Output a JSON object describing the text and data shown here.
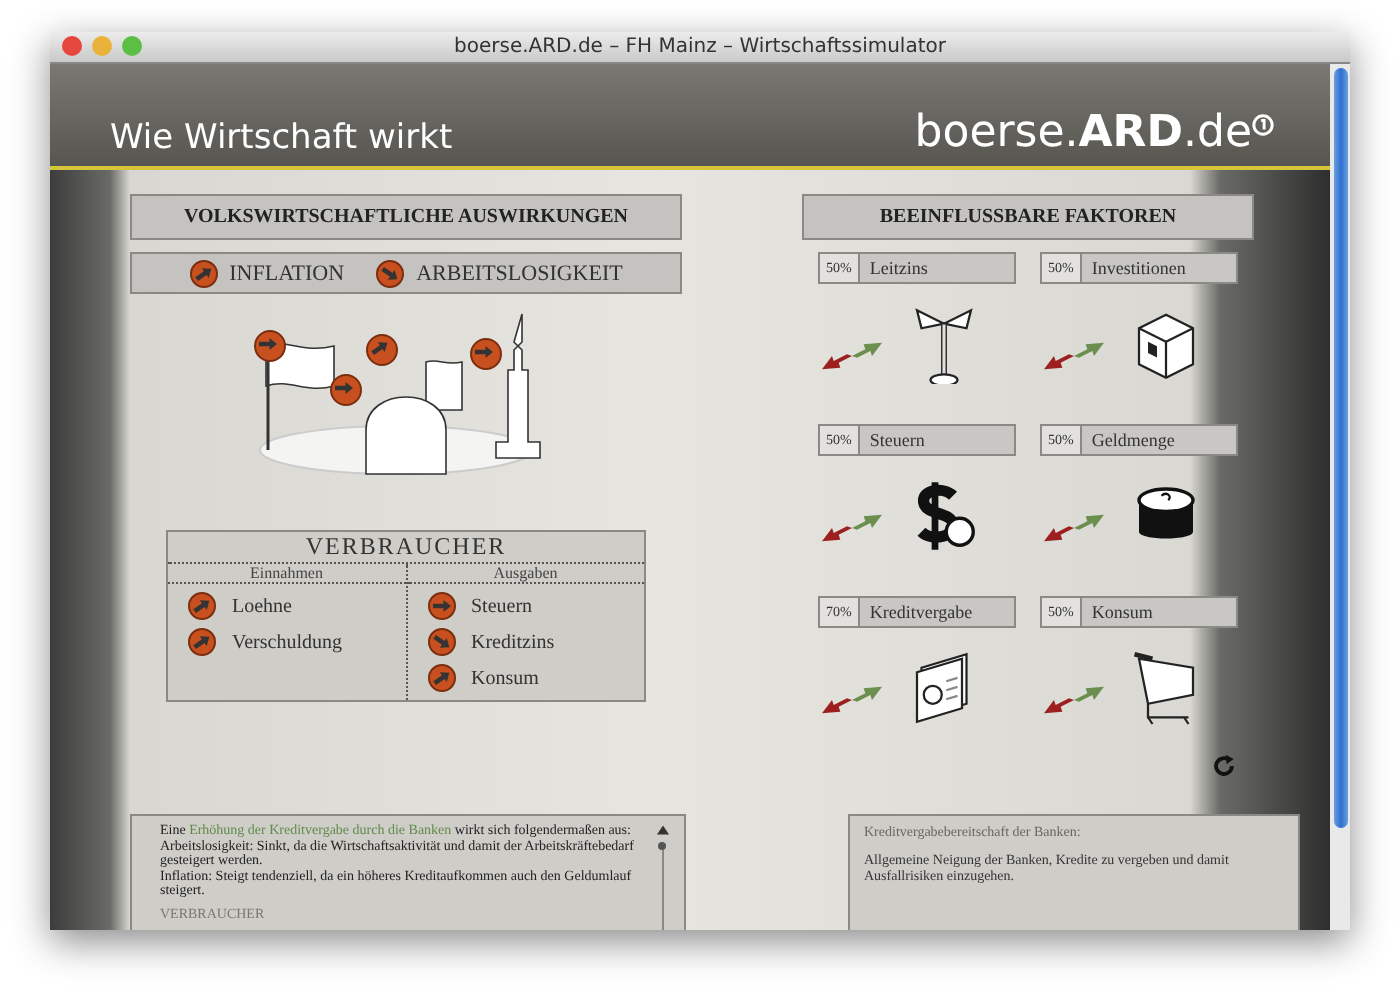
{
  "window": {
    "title": "boerse.ARD.de – FH Mainz – Wirtschaftssimulator"
  },
  "header": {
    "title": "Wie Wirtschaft wirkt",
    "logo_plain": "boerse.",
    "logo_bold": "ARD",
    "logo_tail": ".de"
  },
  "effects": {
    "title": "VOLKSWIRTSCHAFTLICHE AUSWIRKUNGEN",
    "indicators": [
      {
        "label": "INFLATION",
        "kind": "up"
      },
      {
        "label": "ARBEITSLOSIGKEIT",
        "kind": "down"
      }
    ],
    "scene_badges": [
      {
        "kind": "flat"
      },
      {
        "kind": "up"
      },
      {
        "kind": "flat"
      },
      {
        "kind": "flat"
      }
    ],
    "consumer": {
      "title": "VERBRAUCHER",
      "columns": [
        {
          "heading": "Einnahmen",
          "items": [
            {
              "label": "Loehne",
              "kind": "up"
            },
            {
              "label": "Verschuldung",
              "kind": "up"
            }
          ]
        },
        {
          "heading": "Ausgaben",
          "items": [
            {
              "label": "Steuern",
              "kind": "flat"
            },
            {
              "label": "Kreditzins",
              "kind": "down"
            },
            {
              "label": "Konsum",
              "kind": "up"
            }
          ]
        }
      ]
    }
  },
  "factors": {
    "title": "BEEINFLUSSBARE FAKTOREN",
    "items": [
      {
        "percent": "50%",
        "label": "Leitzins",
        "kind": "stand"
      },
      {
        "percent": "50%",
        "label": "Investitionen",
        "kind": "box"
      },
      {
        "percent": "50%",
        "label": "Steuern",
        "kind": "money"
      },
      {
        "percent": "50%",
        "label": "Geldmenge",
        "kind": "coins"
      },
      {
        "percent": "70%",
        "label": "Kreditvergabe",
        "kind": "document"
      },
      {
        "percent": "50%",
        "label": "Konsum",
        "kind": "cart"
      }
    ]
  },
  "explanation": {
    "before": "Eine ",
    "highlight": "Erhöhung der Kreditvergabe durch die Banken",
    "after": " wirkt sich folgendermaßen aus:",
    "lines": [
      "Arbeitslosigkeit: Sinkt, da die Wirtschaftsaktivität und damit der Arbeitskräftebedarf gesteigert werden.",
      "Inflation: Steigt tendenziell, da ein höheres Kreditaufkommen auch den Geldumlauf steigert."
    ],
    "section": "VERBRAUCHER"
  },
  "definition": {
    "title": "Kreditvergabebereitschaft der Banken:",
    "text": "Allgemeine Neigung der Banken, Kredite zu vergeben und damit Ausfallrisiken einzugehen."
  }
}
